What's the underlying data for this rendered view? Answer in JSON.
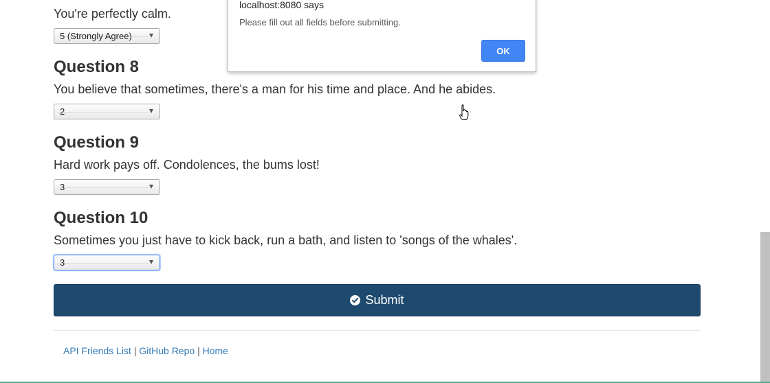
{
  "questions": {
    "q7": {
      "text": "You're perfectly calm.",
      "selected": "5 (Strongly Agree)"
    },
    "q8": {
      "heading": "Question 8",
      "text": "You believe that sometimes, there's a man for his time and place. And he abides.",
      "selected": "2"
    },
    "q9": {
      "heading": "Question 9",
      "text": "Hard work pays off. Condolences, the bums lost!",
      "selected": "3"
    },
    "q10": {
      "heading": "Question 10",
      "text": "Sometimes you just have to kick back, run a bath, and listen to 'songs of the whales'.",
      "selected": "3"
    }
  },
  "submit": {
    "label": "Submit",
    "icon": "check-circle-icon"
  },
  "footer": {
    "link1": "API Friends List",
    "sep1": " | ",
    "link2": "GitHub Repo",
    "sep2": " | ",
    "link3": "Home"
  },
  "dialog": {
    "title": "localhost:8080 says",
    "message": "Please fill out all fields before submitting.",
    "ok_label": "OK"
  },
  "colors": {
    "submit_bg": "#1f4a70",
    "link": "#337ab7",
    "ok_button": "#4285f4"
  }
}
